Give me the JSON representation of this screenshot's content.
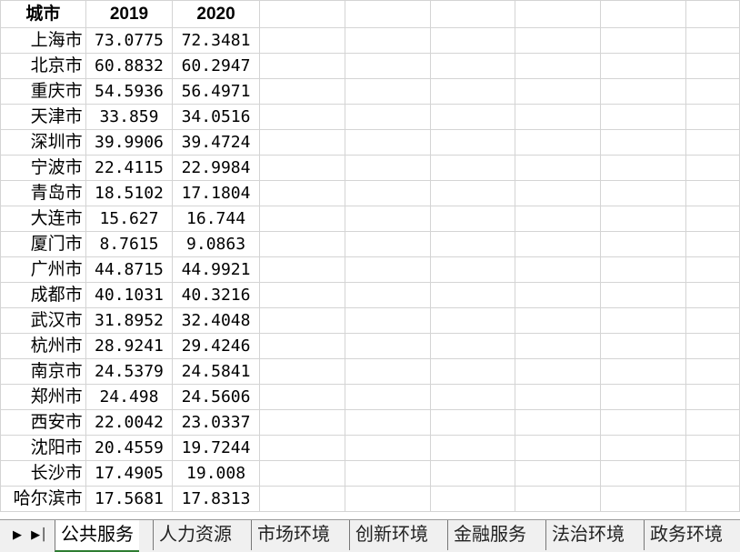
{
  "sheet": {
    "headers": [
      "城市",
      "2019",
      "2020"
    ],
    "rows": [
      {
        "city": "上海市",
        "y2019": "73.0775",
        "y2020": "72.3481"
      },
      {
        "city": "北京市",
        "y2019": "60.8832",
        "y2020": "60.2947"
      },
      {
        "city": "重庆市",
        "y2019": "54.5936",
        "y2020": "56.4971"
      },
      {
        "city": "天津市",
        "y2019": "33.859",
        "y2020": "34.0516"
      },
      {
        "city": "深圳市",
        "y2019": "39.9906",
        "y2020": "39.4724"
      },
      {
        "city": "宁波市",
        "y2019": "22.4115",
        "y2020": "22.9984"
      },
      {
        "city": "青岛市",
        "y2019": "18.5102",
        "y2020": "17.1804"
      },
      {
        "city": "大连市",
        "y2019": "15.627",
        "y2020": "16.744"
      },
      {
        "city": "厦门市",
        "y2019": "8.7615",
        "y2020": "9.0863"
      },
      {
        "city": "广州市",
        "y2019": "44.8715",
        "y2020": "44.9921"
      },
      {
        "city": "成都市",
        "y2019": "40.1031",
        "y2020": "40.3216"
      },
      {
        "city": "武汉市",
        "y2019": "31.8952",
        "y2020": "32.4048"
      },
      {
        "city": "杭州市",
        "y2019": "28.9241",
        "y2020": "29.4246"
      },
      {
        "city": "南京市",
        "y2019": "24.5379",
        "y2020": "24.5841"
      },
      {
        "city": "郑州市",
        "y2019": "24.498",
        "y2020": "24.5606"
      },
      {
        "city": "西安市",
        "y2019": "22.0042",
        "y2020": "23.0337"
      },
      {
        "city": "沈阳市",
        "y2019": "20.4559",
        "y2020": "19.7244"
      },
      {
        "city": "长沙市",
        "y2019": "17.4905",
        "y2020": "19.008"
      },
      {
        "city": "哈尔滨市",
        "y2019": "17.5681",
        "y2020": "17.8313"
      }
    ]
  },
  "tabs": [
    {
      "label": "公共服务",
      "active": true
    },
    {
      "label": "人力资源",
      "active": false
    },
    {
      "label": "市场环境",
      "active": false
    },
    {
      "label": "创新环境",
      "active": false
    },
    {
      "label": "金融服务",
      "active": false
    },
    {
      "label": "法治环境",
      "active": false
    },
    {
      "label": "政务环境",
      "active": false
    }
  ],
  "nav": {
    "prev_icon": "triangle-right-icon",
    "next_icon": "triangle-right-bar-icon"
  },
  "colors": {
    "grid": "#d4d4d4",
    "tab_bg": "#f0f0f0",
    "active_tab_underline": "#2e7d32"
  }
}
